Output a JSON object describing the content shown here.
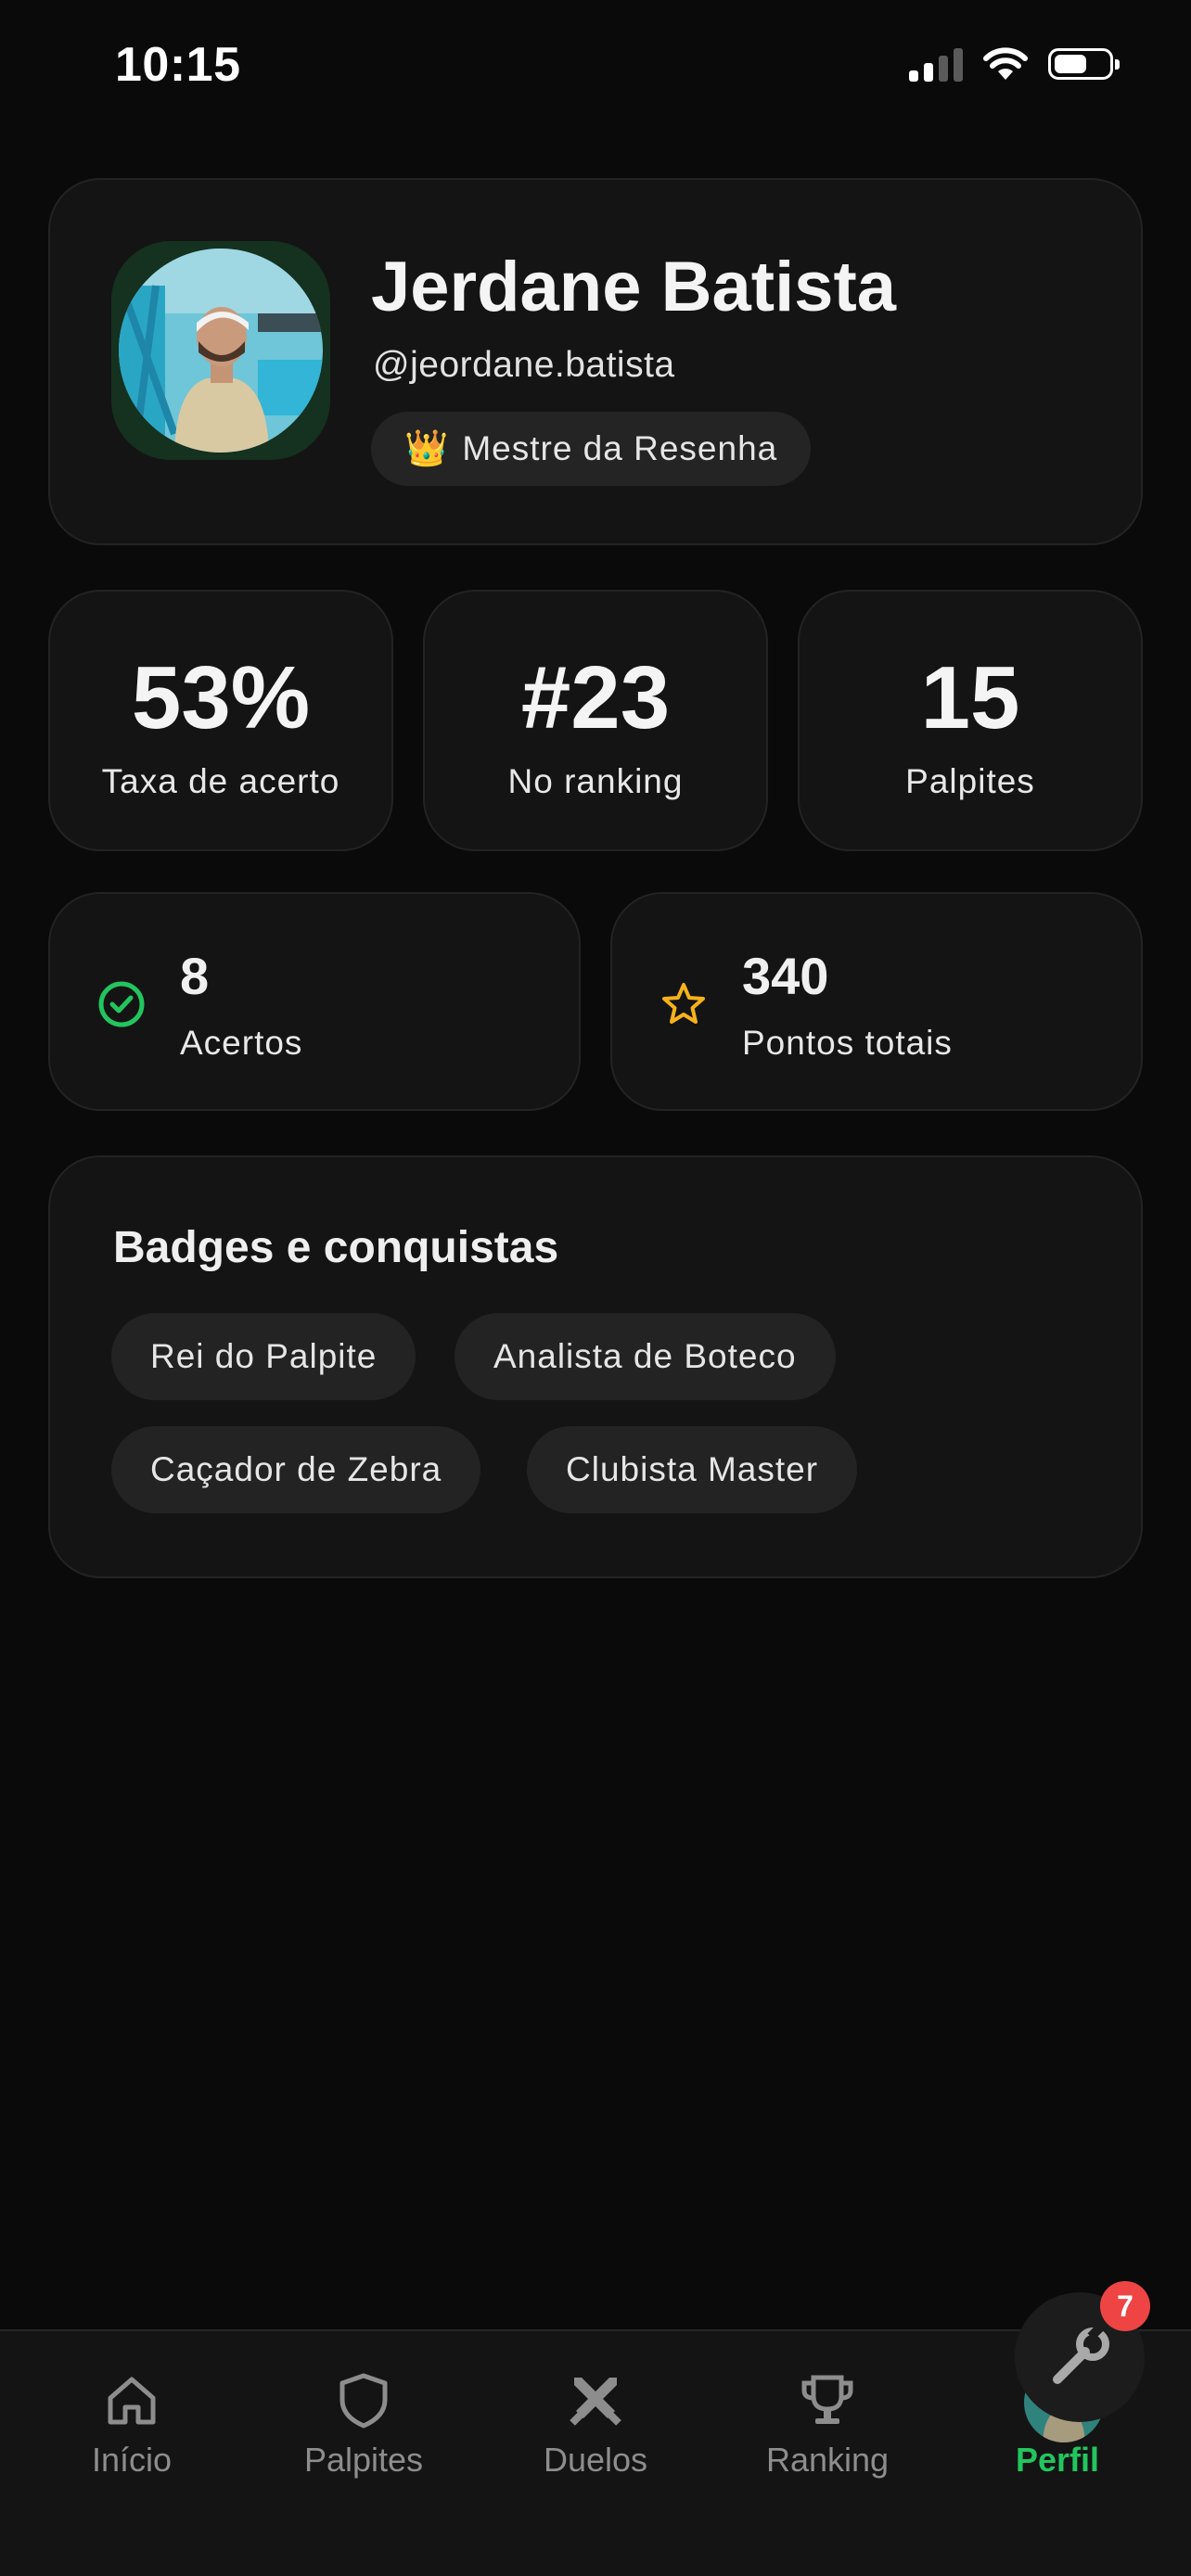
{
  "status_bar": {
    "time": "10:15"
  },
  "profile": {
    "name": "Jerdane Batista",
    "handle": "@jeordane.batista",
    "title": "Mestre da Resenha",
    "title_emoji": "👑"
  },
  "stats": [
    {
      "value": "53%",
      "label": "Taxa de acerto"
    },
    {
      "value": "#23",
      "label": "No ranking"
    },
    {
      "value": "15",
      "label": "Palpites"
    }
  ],
  "mini_stats": [
    {
      "value": "8",
      "label": "Acertos",
      "icon": "check-circle-icon",
      "color": "#22c55e"
    },
    {
      "value": "340",
      "label": "Pontos totais",
      "icon": "star-icon",
      "color": "#f5b21a"
    }
  ],
  "badges": {
    "title": "Badges e conquistas",
    "items": [
      "Rei do Palpite",
      "Analista de Boteco",
      "Caçador de Zebra",
      "Clubista Master"
    ]
  },
  "tabs": [
    {
      "label": "Início",
      "icon": "home-icon"
    },
    {
      "label": "Palpites",
      "icon": "shield-icon"
    },
    {
      "label": "Duelos",
      "icon": "crossed-swords-icon"
    },
    {
      "label": "Ranking",
      "icon": "trophy-icon"
    },
    {
      "label": "Perfil",
      "icon": "avatar-icon",
      "active": true
    }
  ],
  "fab": {
    "icon": "wrench-icon",
    "badge": "7"
  },
  "colors": {
    "accent": "#22c55e",
    "background": "#0a0a0a",
    "card": "#141414",
    "notification": "#ef4444",
    "star": "#f5b21a"
  }
}
